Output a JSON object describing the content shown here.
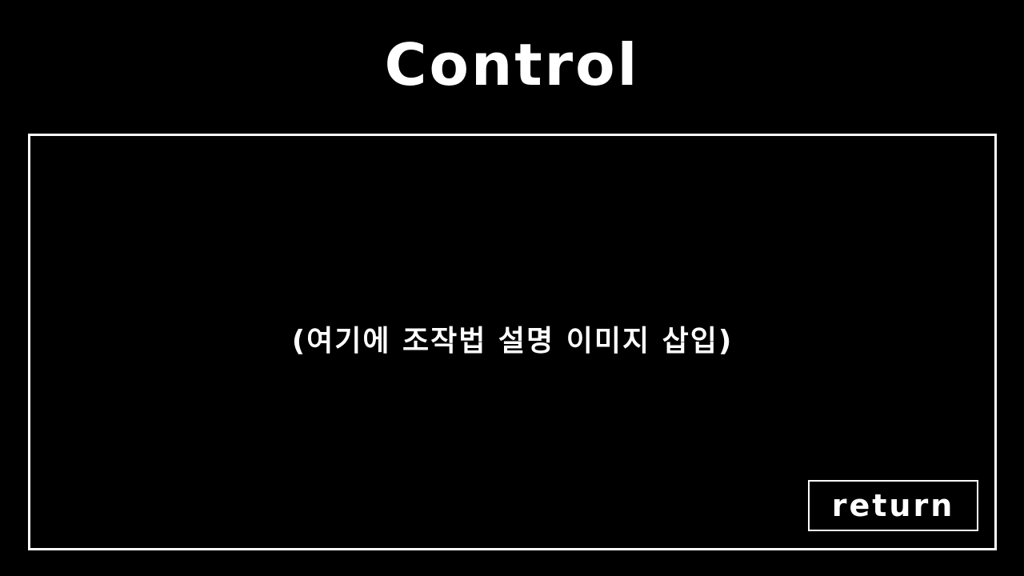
{
  "screen": {
    "title": "Control"
  },
  "panel": {
    "placeholder_text": "(여기에 조작법 설명 이미지 삽입)"
  },
  "buttons": {
    "return_label": "return"
  },
  "colors": {
    "background": "#000000",
    "foreground": "#ffffff"
  }
}
